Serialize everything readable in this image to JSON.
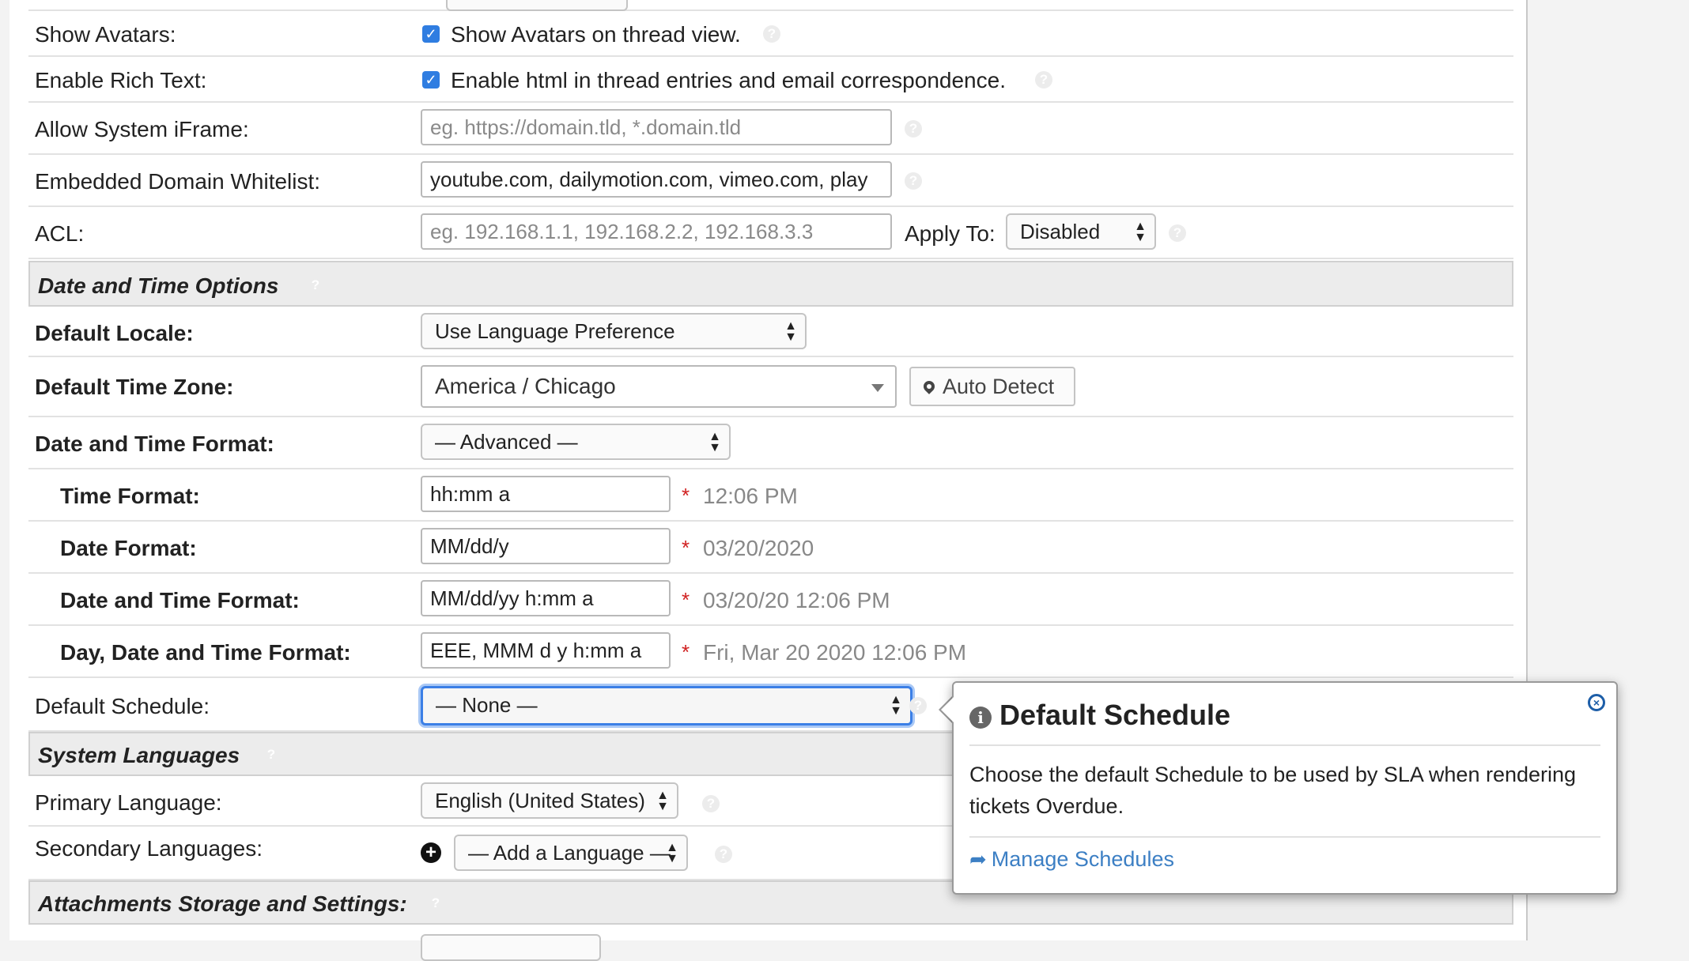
{
  "settings": {
    "show_avatars": {
      "label": "Show Avatars:",
      "checkbox_text": "Show Avatars on thread view.",
      "checked": true
    },
    "rich_text": {
      "label": "Enable Rich Text:",
      "checkbox_text": "Enable html in thread entries and email correspondence.",
      "checked": true
    },
    "iframe": {
      "label": "Allow System iFrame:",
      "placeholder": "eg. https://domain.tld, *.domain.tld",
      "value": ""
    },
    "whitelist": {
      "label": "Embedded Domain Whitelist:",
      "value": "youtube.com, dailymotion.com, vimeo.com, play"
    },
    "acl": {
      "label": "ACL:",
      "placeholder": "eg. 192.168.1.1, 192.168.2.2, 192.168.3.3",
      "apply_label": "Apply To:",
      "apply_value": "Disabled"
    }
  },
  "date_time": {
    "section_title": "Date and Time Options",
    "locale": {
      "label": "Default Locale:",
      "value": "Use Language Preference"
    },
    "timezone": {
      "label": "Default Time Zone:",
      "value": "America / Chicago",
      "auto_detect": "Auto Detect"
    },
    "format": {
      "label": "Date and Time Format:",
      "value": "— Advanced —"
    },
    "time_format": {
      "label": "Time Format:",
      "value": "hh:mm a",
      "preview": "12:06 PM"
    },
    "date_format": {
      "label": "Date Format:",
      "value": "MM/dd/y",
      "preview": "03/20/2020"
    },
    "datetime_format": {
      "label": "Date and Time Format:",
      "value": "MM/dd/yy h:mm a",
      "preview": "03/20/20 12:06 PM"
    },
    "day_datetime_format": {
      "label": "Day, Date and Time Format:",
      "value": "EEE, MMM d y h:mm a",
      "preview": "Fri, Mar 20 2020 12:06 PM"
    },
    "schedule": {
      "label": "Default Schedule:",
      "value": "— None —"
    },
    "required_mark": "*"
  },
  "languages": {
    "section_title": "System Languages",
    "primary": {
      "label": "Primary Language:",
      "value": "English (United States)"
    },
    "secondary": {
      "label": "Secondary Languages:",
      "value": "— Add a Language —"
    }
  },
  "attachments": {
    "section_title": "Attachments Storage and Settings:"
  },
  "popup": {
    "title": "Default Schedule",
    "body": "Choose the default Schedule to be used by SLA when rendering tickets Overdue.",
    "link": "Manage Schedules"
  },
  "icons": {
    "help": "question-circle-icon",
    "info": "info-circle-icon",
    "close": "close-circle-icon",
    "pin": "map-marker-icon",
    "share": "share-arrow-icon",
    "plus": "plus-circle-icon"
  },
  "colors": {
    "accent": "#2f7de1",
    "link": "#3c7fc4",
    "required": "#d02020",
    "section_bg": "#ececec"
  }
}
